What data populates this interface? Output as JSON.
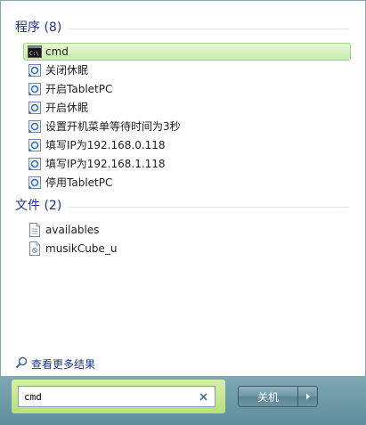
{
  "sections": {
    "programs_header": "程序 (8)",
    "files_header": "文件 (2)"
  },
  "programs": [
    {
      "label": "cmd",
      "icon": "cmd-console-icon",
      "selected": true
    },
    {
      "label": "关闭休眠",
      "icon": "shortcut-icon"
    },
    {
      "label": "开启TabletPC",
      "icon": "shortcut-icon"
    },
    {
      "label": "开启休眠",
      "icon": "shortcut-icon"
    },
    {
      "label": "设置开机菜单等待时间为3秒",
      "icon": "shortcut-icon"
    },
    {
      "label": "填写IP为192.168.0.118",
      "icon": "shortcut-icon"
    },
    {
      "label": "填写IP为192.168.1.118",
      "icon": "shortcut-icon"
    },
    {
      "label": "停用TabletPC",
      "icon": "shortcut-icon"
    }
  ],
  "files": [
    {
      "label": "availables",
      "icon": "text-file-icon"
    },
    {
      "label": "musikCube_u",
      "icon": "document-file-icon"
    }
  ],
  "search_more": {
    "label": "查看更多结果",
    "icon": "search-icon"
  },
  "search": {
    "value": "cmd"
  },
  "shutdown": {
    "label": "关机"
  },
  "colors": {
    "selection": "#c7ecae",
    "header_text": "#1e3287"
  }
}
